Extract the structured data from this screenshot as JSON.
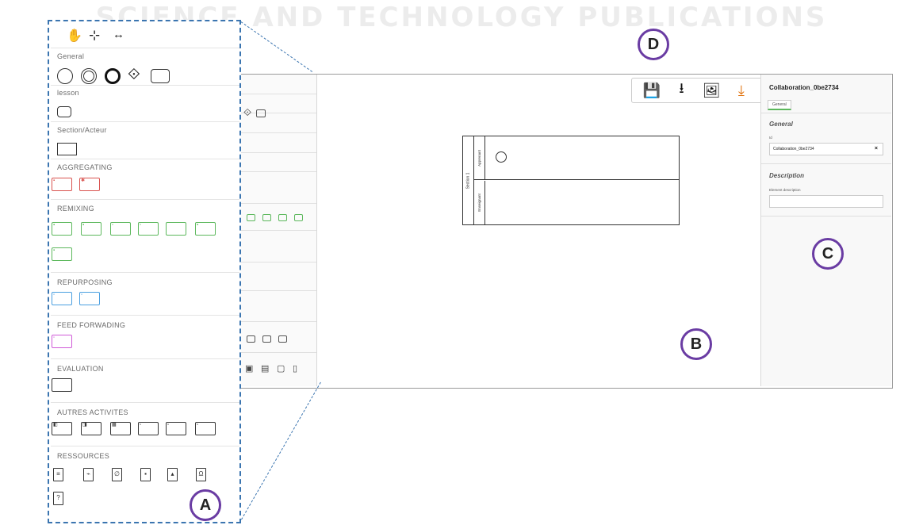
{
  "banner": {
    "text": "SCIENCE AND TECHNOLOGY PUBLICATIONS"
  },
  "palette": {
    "sections": {
      "general": "General",
      "lesson": "lesson",
      "section_acteur": "Section/Acteur",
      "aggregating": "AGGREGATING",
      "remixing": "REMIXING",
      "repurposing": "REPURPOSING",
      "feed_forwading": "FEED FORWADING",
      "evaluation": "EVALUATION",
      "autres_activites": "AUTRES ACTIVITES",
      "ressources": "RESSOURCES"
    },
    "tools": [
      "hand-tool",
      "lasso-tool",
      "space-tool"
    ],
    "colors": {
      "aggregating": "#d9534f",
      "remixing": "#5cb85c",
      "repurposing": "#4a9fe0",
      "feed_forwading": "#d05ad8"
    }
  },
  "toolbar": {
    "buttons": [
      {
        "name": "save",
        "glyph": "💾"
      },
      {
        "name": "download",
        "glyph": "⭳"
      },
      {
        "name": "export-image",
        "glyph": "🖼"
      },
      {
        "name": "export-moodle",
        "glyph": "⤓"
      },
      {
        "name": "home",
        "glyph": "⌂"
      },
      {
        "name": "info",
        "glyph": "ⓘ"
      }
    ]
  },
  "diagram": {
    "pool_label": "Section 1",
    "lanes": [
      "Apprenant",
      "Enseignant"
    ]
  },
  "properties": {
    "title": "Collaboration_0be2734",
    "tab": "General",
    "group_general": "General",
    "id_label": "Id",
    "id_value": "Collaboration_0be2734",
    "clear": "×",
    "group_description": "Description",
    "description_label": "Element description"
  },
  "callouts": {
    "a": "A",
    "b": "B",
    "c": "C",
    "d": "D"
  },
  "colors": {
    "accent": "#6a3ca3",
    "dashed": "#3b75b0"
  }
}
